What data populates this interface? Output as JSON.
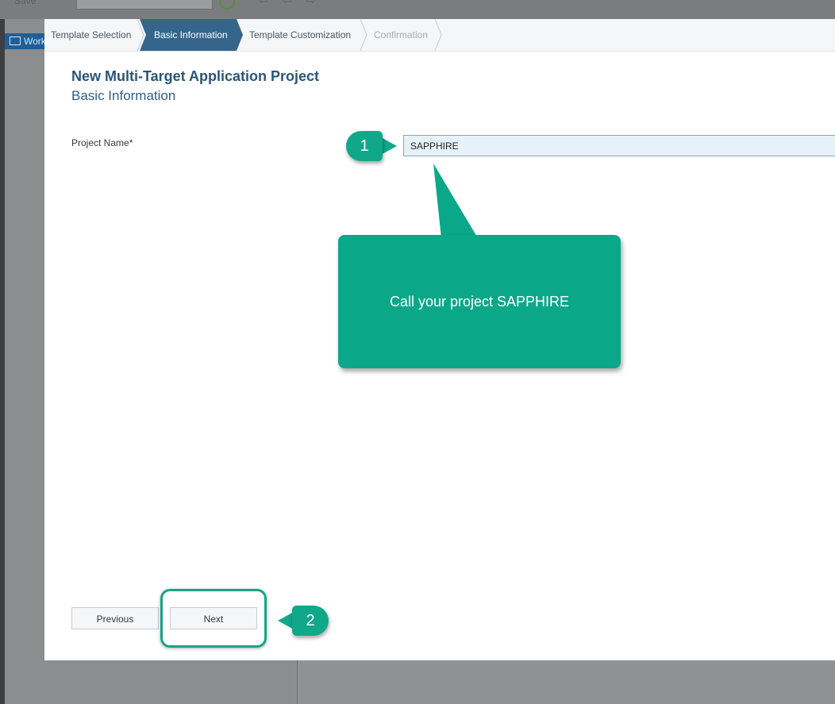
{
  "ide": {
    "toolbar": {
      "save_label": "Save"
    },
    "workspace_label": "Workspace"
  },
  "wizard": {
    "steps": [
      {
        "label": "Template Selection",
        "state": "done"
      },
      {
        "label": "Basic Information",
        "state": "active"
      },
      {
        "label": "Template Customization",
        "state": "upcoming"
      },
      {
        "label": "Confirmation",
        "state": "disabled"
      }
    ],
    "title": "New Multi-Target Application Project",
    "subtitle": "Basic Information",
    "project_name_label": "Project Name*",
    "project_name_value": "SAPPHIRE",
    "previous_label": "Previous",
    "next_label": "Next"
  },
  "annotations": {
    "badge_1": "1",
    "badge_2": "2",
    "callout_text": "Call your project SAPPHIRE"
  },
  "colors": {
    "accent": "#35658b",
    "annotation": "#0aa889"
  }
}
